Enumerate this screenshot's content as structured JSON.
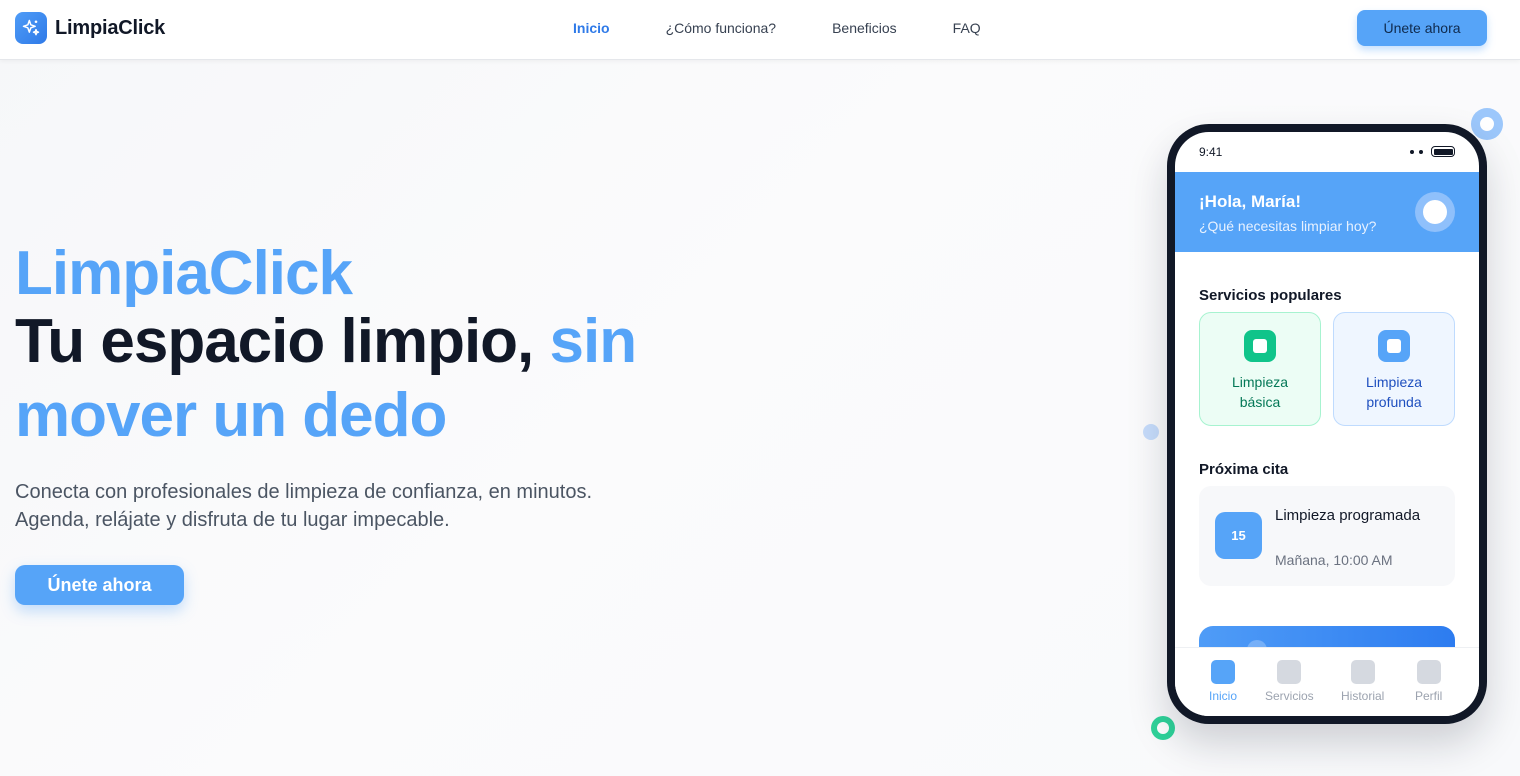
{
  "nav": {
    "brand": "LimpiaClick",
    "links": [
      {
        "label": "Inicio",
        "active": true
      },
      {
        "label": "¿Cómo funciona?",
        "active": false
      },
      {
        "label": "Beneficios",
        "active": false
      },
      {
        "label": "FAQ",
        "active": false
      }
    ],
    "cta_label": "Únete ahora"
  },
  "hero": {
    "brand_title": "LimpiaClick",
    "headline_main": "Tu espacio limpio,",
    "headline_accent": "sin mover un dedo",
    "subtitle_line1": "Conecta con profesionales de limpieza de confianza, en minutos.",
    "subtitle_line2": "Agenda, relájate y disfruta de tu lugar impecable.",
    "cta_label": "Únete ahora"
  },
  "phone": {
    "status_time": "9:41",
    "greeting": "¡Hola, María!",
    "greeting_sub": "¿Qué necesitas limpiar hoy?",
    "popular_title": "Servicios populares",
    "services": [
      {
        "label": "Limpieza básica",
        "icon": "square-icon"
      },
      {
        "label": "Limpieza profunda",
        "icon": "square-icon"
      }
    ],
    "next_title": "Próxima cita",
    "appointment": {
      "day": "15",
      "title": "Limpieza programada",
      "time": "Mañana, 10:00 AM"
    },
    "tabs": [
      {
        "label": "Inicio",
        "active": true
      },
      {
        "label": "Servicios",
        "active": false
      },
      {
        "label": "Historial",
        "active": false
      },
      {
        "label": "Perfil",
        "active": false
      }
    ]
  },
  "colors": {
    "accent": "#56a4f8",
    "accent_dark": "#2f7ae8",
    "heading": "#111827",
    "success": "#10c48a"
  }
}
